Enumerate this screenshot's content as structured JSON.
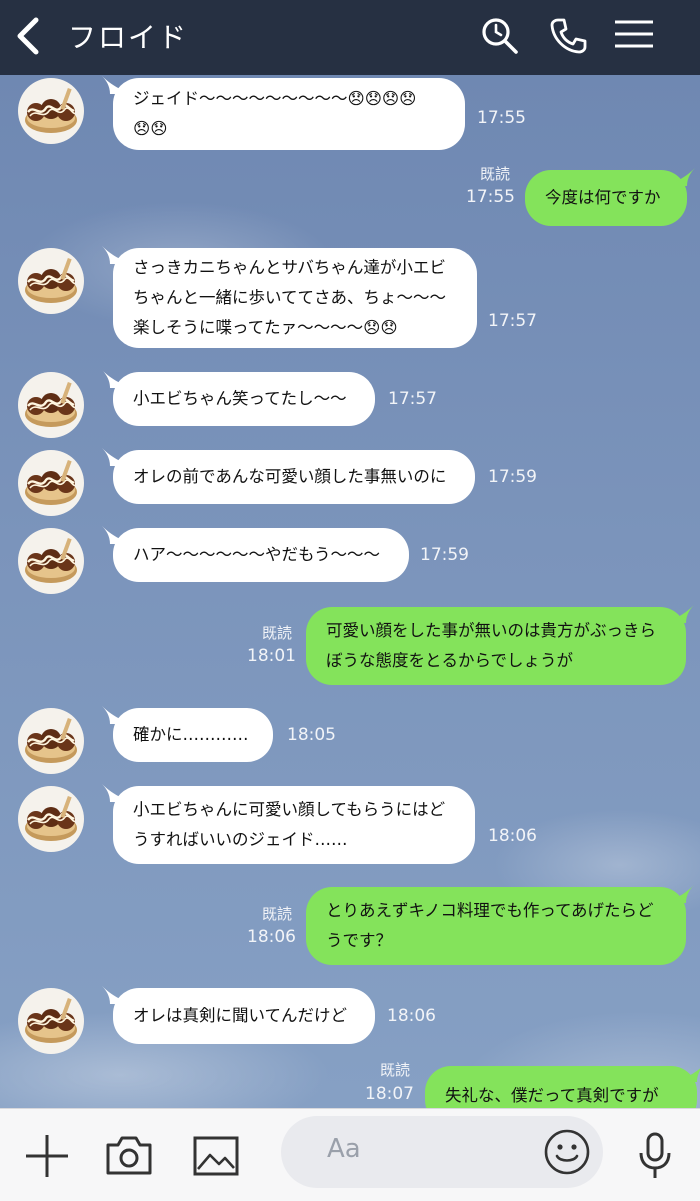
{
  "header": {
    "contact_name": "フロイド",
    "icons": [
      "back-icon",
      "search-icon",
      "phone-icon",
      "menu-icon"
    ]
  },
  "messages": [
    {
      "side": "in",
      "lines": [
        "ジェイド〜〜〜〜〜〜〜〜〜😞😞😞😞",
        "😞😞"
      ],
      "time": "17:55"
    },
    {
      "side": "out",
      "lines": [
        "今度は何ですか"
      ],
      "time": "17:55",
      "read": "既読"
    },
    {
      "side": "in",
      "lines": [
        "さっきカニちゃんとサバちゃん達が小エビ",
        "ちゃんと一緒に歩いててさあ、ちょ〜〜〜",
        "楽しそうに喋ってたァ〜〜〜〜😞😞"
      ],
      "time": "17:57"
    },
    {
      "side": "in",
      "lines": [
        "小エビちゃん笑ってたし〜〜"
      ],
      "time": "17:57"
    },
    {
      "side": "in",
      "lines": [
        "オレの前であんな可愛い顔した事無いのに"
      ],
      "time": "17:59"
    },
    {
      "side": "in",
      "lines": [
        "ハア〜〜〜〜〜〜やだもう〜〜〜"
      ],
      "time": "17:59"
    },
    {
      "side": "out",
      "lines": [
        "可愛い顔をした事が無いのは貴方がぶっきら",
        "ぼうな態度をとるからでしょうが"
      ],
      "time": "18:01",
      "read": "既読"
    },
    {
      "side": "in",
      "lines": [
        "確かに…………"
      ],
      "time": "18:05"
    },
    {
      "side": "in",
      "lines": [
        "小エビちゃんに可愛い顔してもらうにはど",
        "うすればいいのジェイド……"
      ],
      "time": "18:06"
    },
    {
      "side": "out",
      "lines": [
        "とりあえずキノコ料理でも作ってあげたらど",
        "うです？"
      ],
      "time": "18:06",
      "read": "既読"
    },
    {
      "side": "in",
      "lines": [
        "オレは真剣に聞いてんだけど"
      ],
      "time": "18:06"
    },
    {
      "side": "out",
      "lines": [
        "失礼な、僕だって真剣ですが"
      ],
      "time": "18:07",
      "read": "既読"
    }
  ],
  "composer": {
    "placeholder": "Aa",
    "icons": [
      "plus-icon",
      "camera-icon",
      "image-icon",
      "emoji-icon",
      "microphone-icon"
    ]
  },
  "colors": {
    "header_bg": "#263042",
    "incoming_bubble": "#ffffff",
    "outgoing_bubble": "#84e35b",
    "chat_bg": "#7b93b8"
  }
}
